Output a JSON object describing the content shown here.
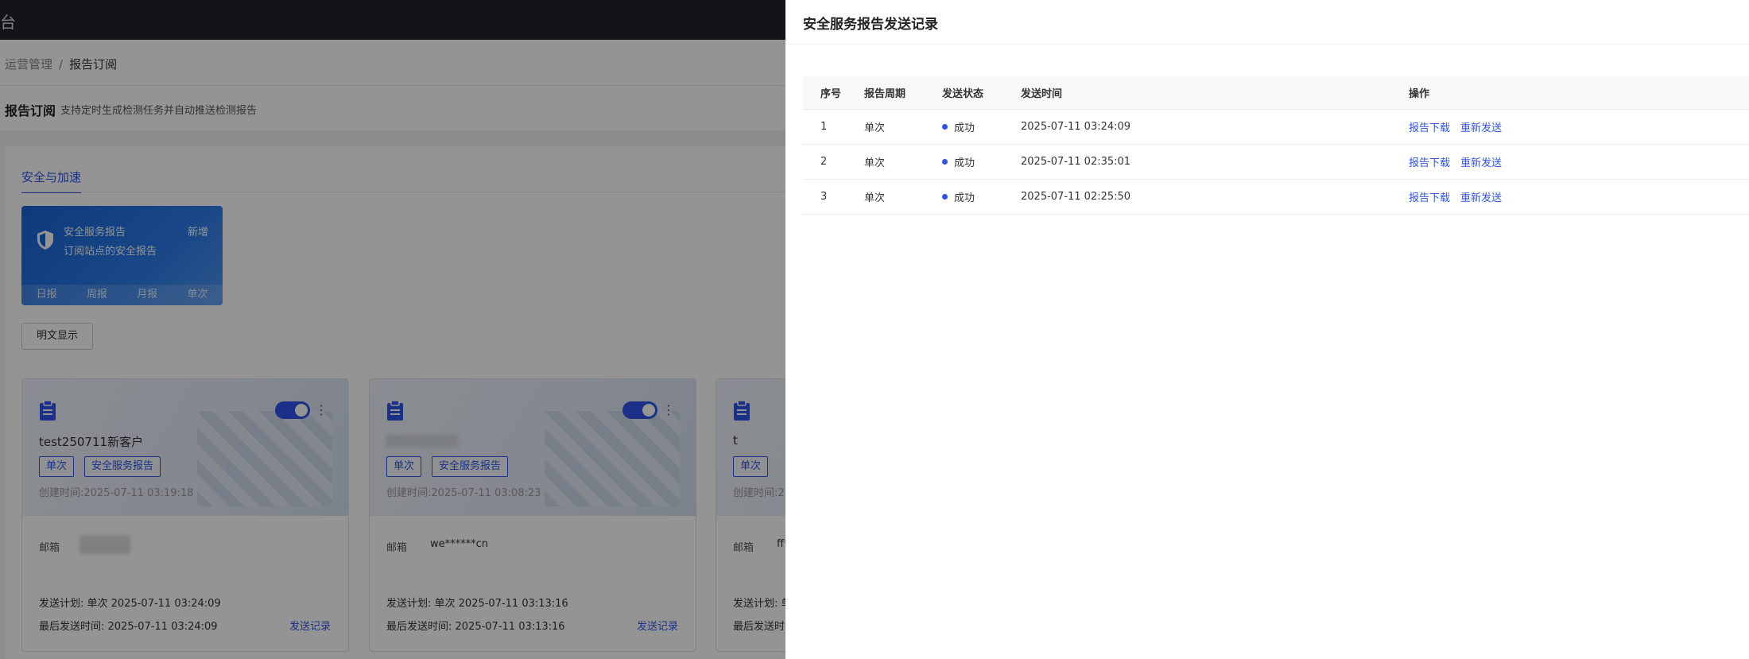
{
  "topbar": {
    "glyph": "台"
  },
  "breadcrumb": {
    "parent": "运营管理",
    "separator": "/",
    "current": "报告订阅"
  },
  "page": {
    "title": "报告订阅",
    "description": "支持定时生成检测任务并自动推送检测报告"
  },
  "tab": {
    "label": "安全与加速"
  },
  "service_card": {
    "title": "安全服务报告",
    "description": "订阅站点的安全报告",
    "add_label": "新增",
    "periods": [
      "日报",
      "周报",
      "月报",
      "单次"
    ]
  },
  "plain_toggle_label": "明文显示",
  "subscriptions": [
    {
      "name": "test250711新客户",
      "tags": [
        "单次",
        "安全服务报告"
      ],
      "created": "创建时间:2025-07-11 03:19:18",
      "mail_label": "邮箱",
      "mail": "",
      "plan": "发送计划: 单次 2025-07-11 03:24:09",
      "last": "最后发送时间: 2025-07-11 03:24:09",
      "link": "发送记录"
    },
    {
      "name": "",
      "tags": [
        "单次",
        "安全服务报告"
      ],
      "created": "创建时间:2025-07-11 03:08:23",
      "mail_label": "邮箱",
      "mail": "we******cn",
      "plan": "发送计划: 单次 2025-07-11 03:13:16",
      "last": "最后发送时间: 2025-07-11 03:13:16",
      "link": "发送记录"
    },
    {
      "name": "t",
      "tags": [
        "单次"
      ],
      "created": "创建时间:2",
      "mail_label": "邮箱",
      "mail": "ff*",
      "plan": "发送计划: 单",
      "last": "最后发送时",
      "link": ""
    }
  ],
  "drawer": {
    "title": "安全服务报告发送记录",
    "columns": [
      "序号",
      "报告周期",
      "发送状态",
      "发送时间",
      "操作"
    ],
    "rows": [
      {
        "index": "1",
        "period": "单次",
        "status": "成功",
        "time": "2025-07-11 03:24:09"
      },
      {
        "index": "2",
        "period": "单次",
        "status": "成功",
        "time": "2025-07-11 02:35:01"
      },
      {
        "index": "3",
        "period": "单次",
        "status": "成功",
        "time": "2025-07-11 02:25:50"
      }
    ],
    "actions": {
      "download": "报告下载",
      "resend": "重新发送"
    }
  },
  "colors": {
    "accent": "#2f54eb",
    "topbar": "#22242b",
    "success_dot": "#2f54eb"
  }
}
